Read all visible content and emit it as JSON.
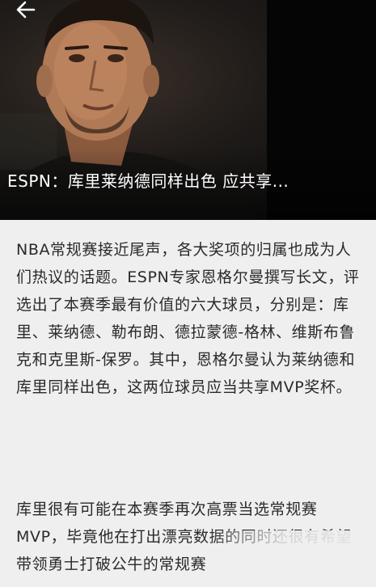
{
  "header": {
    "back_icon": "back-arrow-icon",
    "photo_icon": "player-photo",
    "headline": "ESPN：库里莱纳德同样出色 应共享..."
  },
  "article": {
    "paragraph_1": "NBA常规赛接近尾声，各大奖项的归属也成为人们热议的话题。ESPN专家恩格尔曼撰写长文，评选出了本赛季最有价值的六大球员，分别是：库里、莱纳德、勒布朗、德拉蒙德-格林、维斯布鲁克和克里斯-保罗。其中，恩格尔曼认为莱纳德和库里同样出色，这两位球员应当共享MVP奖杯。",
    "paragraph_2": "库里很有可能在本赛季再次高票当选常规赛MVP，毕竟他在打出漂亮数据的同时还很有希望带领勇士打破公牛的常规赛"
  },
  "colors": {
    "background": "#efefef",
    "text": "#2a2a2a",
    "headline": "#ffffff"
  }
}
